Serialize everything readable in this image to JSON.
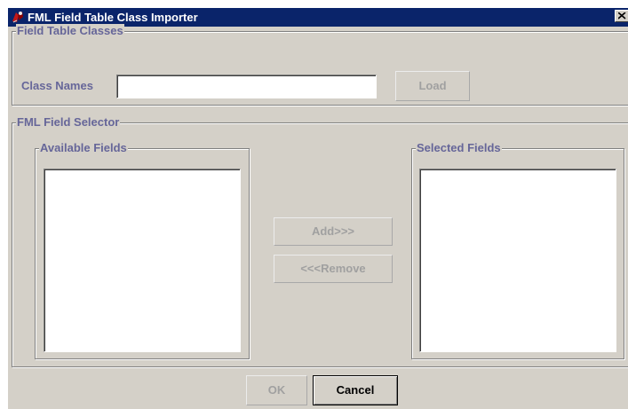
{
  "window": {
    "title": "FML Field Table Class Importer"
  },
  "field_table_classes": {
    "group_title": "Field Table Classes",
    "class_names_label": "Class Names",
    "class_names_value": "",
    "load_button": "Load"
  },
  "fml_field_selector": {
    "group_title": "FML Field Selector",
    "available_fields": {
      "title": "Available Fields",
      "items": []
    },
    "selected_fields": {
      "title": "Selected Fields",
      "items": []
    },
    "add_button": "Add>>>",
    "remove_button": "<<<Remove"
  },
  "footer": {
    "ok_button": "OK",
    "cancel_button": "Cancel"
  },
  "icons": {
    "app": "app-icon",
    "close": "close-icon"
  }
}
